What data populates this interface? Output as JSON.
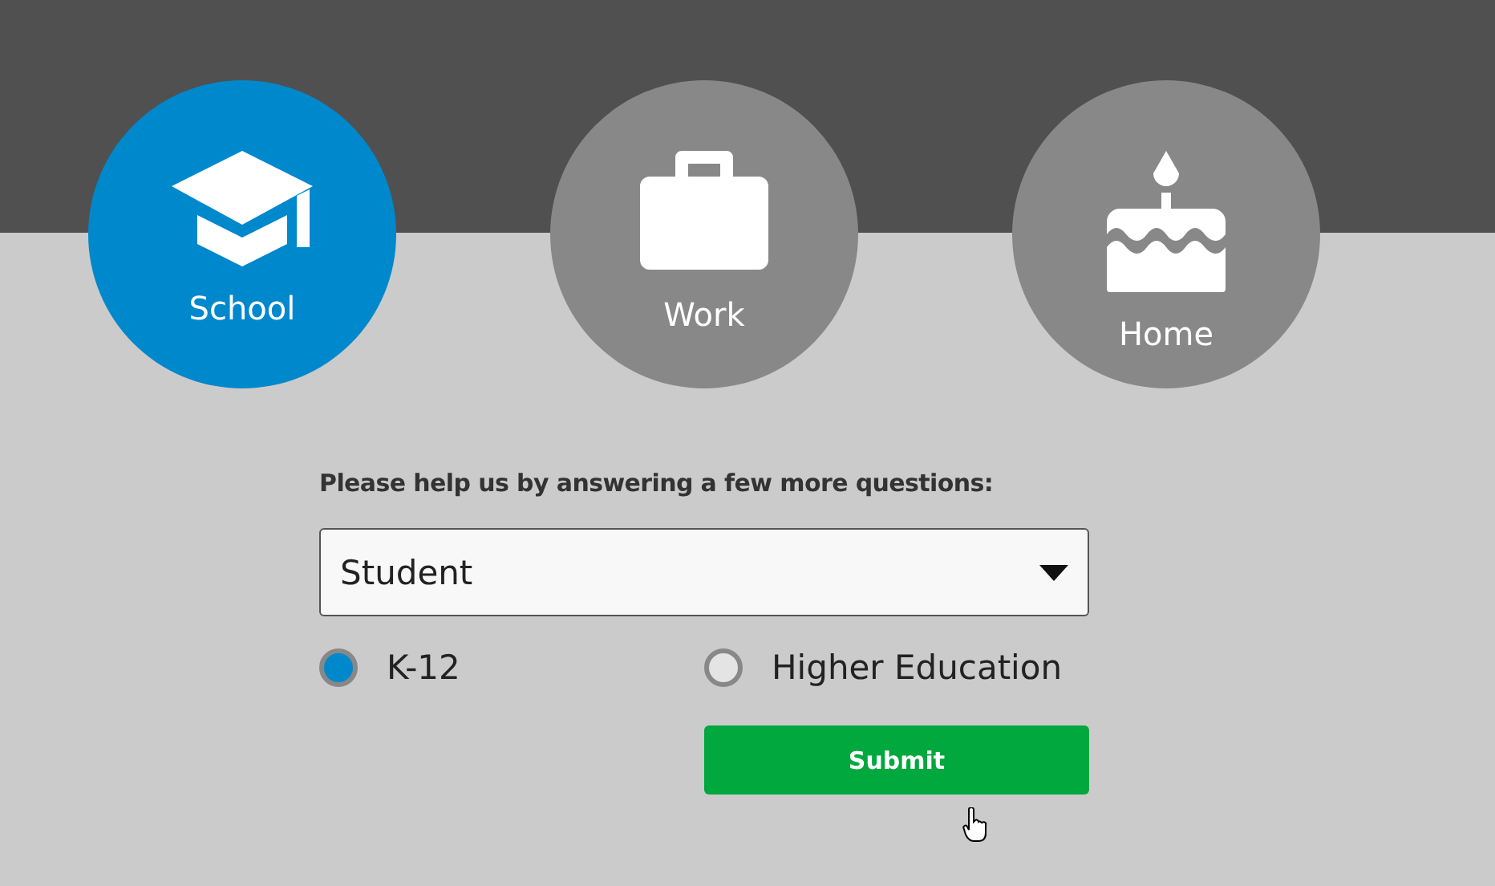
{
  "categories": [
    {
      "label": "School",
      "selected": true
    },
    {
      "label": "Work",
      "selected": false
    },
    {
      "label": "Home",
      "selected": false
    }
  ],
  "form": {
    "prompt": "Please help us by answering a few more questions:",
    "select": {
      "value": "Student"
    },
    "options": [
      {
        "label": "K-12",
        "selected": true
      },
      {
        "label": "Higher Education",
        "selected": false
      }
    ],
    "submit": "Submit"
  }
}
